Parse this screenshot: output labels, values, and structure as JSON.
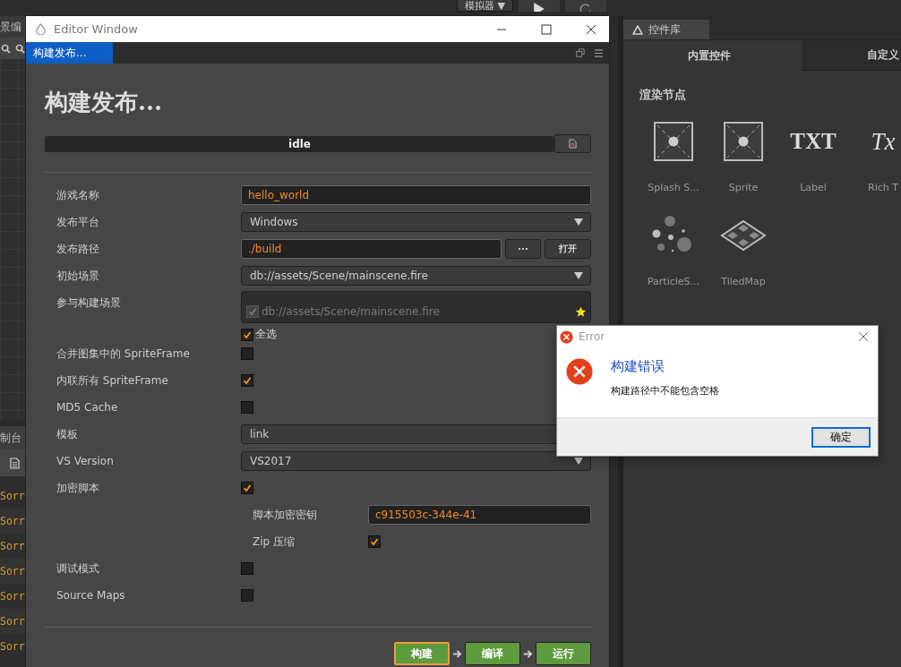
{
  "toolbar": {
    "simulator": {
      "label": "模拟器",
      "caret": "▼"
    }
  },
  "scene_panel": {
    "title": "景编"
  },
  "console_panel": {
    "title": "制台",
    "log_lines": [
      "Sorr",
      "Sorr",
      "Sorr",
      "Sorr",
      "Sorr",
      "Sorr",
      "Sorr"
    ]
  },
  "library_panel": {
    "title": "控件库",
    "tabs": [
      {
        "label": "内置控件",
        "selected": true
      },
      {
        "label": "自定义",
        "selected": false
      }
    ],
    "section": "渲染节点",
    "items": [
      {
        "label": "Splash S...",
        "kind": "sprite"
      },
      {
        "label": "Sprite",
        "kind": "sprite"
      },
      {
        "label": "Label",
        "kind": "glyph",
        "glyph": "TXT"
      },
      {
        "label": "Rich T",
        "kind": "glyph",
        "glyph": "Tx"
      },
      {
        "label": "ParticleS...",
        "kind": "particles"
      },
      {
        "label": "TiledMap",
        "kind": "tiles"
      }
    ]
  },
  "editor_window": {
    "title": "Editor Window",
    "tabs": [
      {
        "label": "构建发布...",
        "selected": true
      }
    ],
    "heading": "构建发布...",
    "status": "idle",
    "fields": [
      {
        "kind": "text",
        "label": "游戏名称",
        "value": "hello_world"
      },
      {
        "kind": "select",
        "label": "发布平台",
        "value": "Windows",
        "caret": true
      },
      {
        "kind": "path",
        "label": "发布路径",
        "value": "./build",
        "buttons": [
          "···",
          "打开"
        ]
      },
      {
        "kind": "select",
        "label": "初始场景",
        "value": "db://assets/Scene/mainscene.fire",
        "caret": true
      },
      {
        "kind": "scenes",
        "label": "参与构建场景",
        "scenes": [
          {
            "path": "db://assets/Scene/mainscene.fire",
            "checked": true,
            "starred": true
          }
        ],
        "select_all": {
          "label": "全选",
          "checked": true
        }
      },
      {
        "kind": "checkbox",
        "label": "合并图集中的 SpriteFrame",
        "checked": false
      },
      {
        "kind": "checkbox",
        "label": "内联所有 SpriteFrame",
        "checked": true
      },
      {
        "kind": "checkbox",
        "label": "MD5 Cache",
        "checked": false
      },
      {
        "kind": "select",
        "label": "模板",
        "value": "link"
      },
      {
        "kind": "select",
        "label": "VS Version",
        "value": "VS2017",
        "caret": true
      },
      {
        "kind": "checkbox",
        "label": "加密脚本",
        "checked": true,
        "children": [
          {
            "kind": "text",
            "label": "脚本加密密钥",
            "value": "c915503c-344e-41"
          },
          {
            "kind": "checkbox",
            "label": "Zip 压缩",
            "checked": true
          }
        ]
      },
      {
        "kind": "checkbox",
        "label": "调试模式",
        "checked": false
      },
      {
        "kind": "checkbox",
        "label": "Source Maps",
        "checked": false
      }
    ],
    "actions": [
      {
        "label": "构建",
        "focused": true
      },
      {
        "label": "编译",
        "focused": false
      },
      {
        "label": "运行",
        "focused": false
      }
    ]
  },
  "dialog": {
    "title": "Error",
    "heading": "构建错误",
    "message": "构建路径中不能包含空格",
    "button": "确定"
  }
}
